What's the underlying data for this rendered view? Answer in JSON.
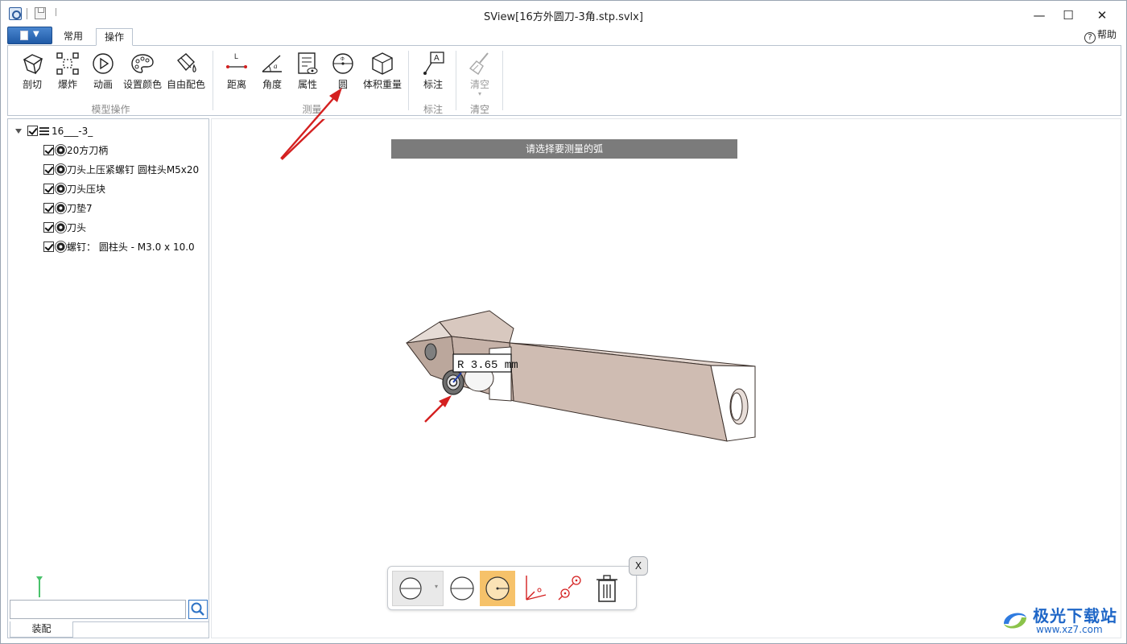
{
  "window": {
    "title": "SView[16方外圆刀-3角.stp.svlx]",
    "minimize": "—",
    "maximize": "☐",
    "close": "✕"
  },
  "tabs": [
    {
      "label": "常用",
      "active": false
    },
    {
      "label": "操作",
      "active": true
    }
  ],
  "help_label": "帮助",
  "ribbon": {
    "groups": [
      {
        "label": "模型操作",
        "buttons": [
          "剖切",
          "爆炸",
          "动画",
          "设置颜色",
          "自由配色"
        ]
      },
      {
        "label": "测量",
        "buttons": [
          "距离",
          "角度",
          "属性",
          "圆",
          "体积重量"
        ]
      },
      {
        "label": "标注",
        "buttons": [
          "标注"
        ]
      },
      {
        "label": "清空",
        "buttons": [
          "清空"
        ]
      }
    ],
    "disabled": [
      "清空"
    ]
  },
  "tree": {
    "root": "16___-3_",
    "children": [
      "20方刀柄",
      "刀头上压紧螺钉 圆柱头M5x20",
      "刀头压块",
      "刀垫7",
      "刀头",
      "螺钉： 圆柱头 - M3.0 x 10.0"
    ]
  },
  "search": {
    "placeholder": "",
    "value": ""
  },
  "bottom_tab": "装配",
  "viewport": {
    "prompt": "请选择要测量的弧",
    "measurement_label": "R 3.65 mm",
    "model_color": "#d7c7bf"
  },
  "float_toolbar": {
    "close_label": "X",
    "tools": [
      "circle-by-edge",
      "circle-three-point",
      "circle-center",
      "axis-measure",
      "zoom-points",
      "delete"
    ],
    "active_tool": "circle-center"
  },
  "watermark": {
    "title": "极光下载站",
    "url": "www.xz7.com"
  },
  "colors": {
    "accent": "#1f5aa6",
    "annotation_arrow": "#d42020",
    "active_tool": "#f6c26a",
    "prompt_bg": "#7b7b7b"
  }
}
